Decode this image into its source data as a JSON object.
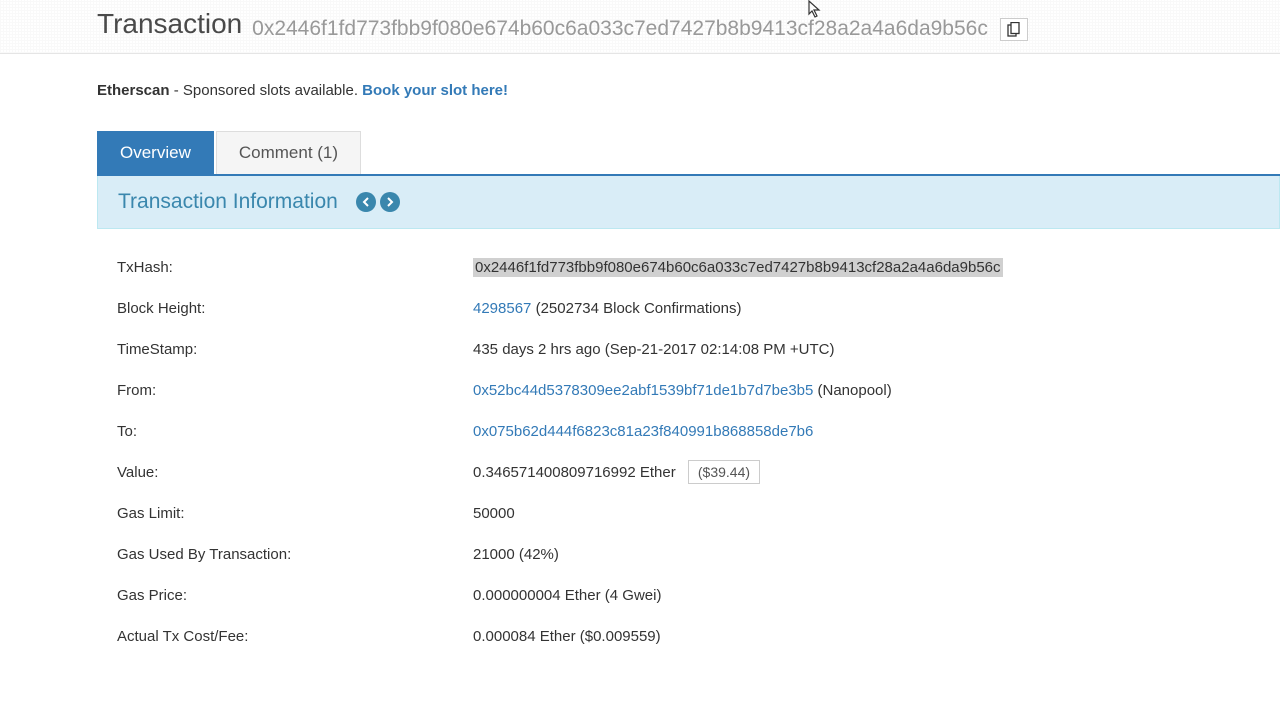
{
  "header": {
    "title": "Transaction",
    "tx_hash": "0x2446f1fd773fbb9f080e674b60c6a033c7ed7427b8b9413cf28a2a4a6da9b56c"
  },
  "sponsor": {
    "brand": "Etherscan",
    "text": " - Sponsored slots available. ",
    "link_text": "Book your slot here!"
  },
  "tabs": {
    "overview": "Overview",
    "comment": "Comment (1)"
  },
  "panel": {
    "title": "Transaction Information"
  },
  "tx": {
    "labels": {
      "txhash": "TxHash:",
      "block_height": "Block Height:",
      "timestamp": "TimeStamp:",
      "from": "From:",
      "to": "To:",
      "value": "Value:",
      "gas_limit": "Gas Limit:",
      "gas_used": "Gas Used By Transaction:",
      "gas_price": "Gas Price:",
      "actual_cost": "Actual Tx Cost/Fee:"
    },
    "txhash": "0x2446f1fd773fbb9f080e674b60c6a033c7ed7427b8b9413cf28a2a4a6da9b56c",
    "block_height": "4298567",
    "block_confirmations": " (2502734 Block Confirmations)",
    "timestamp": "435 days 2 hrs ago (Sep-21-2017 02:14:08 PM +UTC)",
    "from_addr": "0x52bc44d5378309ee2abf1539bf71de1b7d7be3b5",
    "from_label": " (Nanopool)",
    "to_addr": "0x075b62d444f6823c81a23f840991b868858de7b6",
    "value_ether": "0.346571400809716992 Ether",
    "value_usd": "($39.44)",
    "gas_limit": "50000",
    "gas_used": "21000 (42%)",
    "gas_price": "0.000000004 Ether (4 Gwei)",
    "actual_cost": "0.000084 Ether ($0.009559)"
  }
}
